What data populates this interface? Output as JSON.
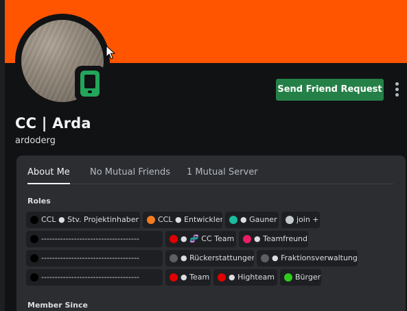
{
  "profile": {
    "display_name": "CC | Arda",
    "username": "ardoderg",
    "banner_color": "#ff5500",
    "status": "mobile-online",
    "status_color": "#23a55a"
  },
  "actions": {
    "send_friend_request_label": "Send Friend Request",
    "more_icon": "more-vertical-icon",
    "button_color": "#248046"
  },
  "tabs": [
    {
      "label": "About Me",
      "active": true
    },
    {
      "label": "No Mutual Friends",
      "active": false
    },
    {
      "label": "1 Mutual Server",
      "active": false
    }
  ],
  "roles": {
    "title": "Roles",
    "items": [
      {
        "label": "CCL ● Stv. Projektinhaber",
        "color": "#000000"
      },
      {
        "label": "CCL ● Entwickler",
        "color": "#f47b20"
      },
      {
        "label": "● Gauner",
        "color": "#1abc9c"
      },
      {
        "label": "join +",
        "color": "#c4c9ce"
      },
      {
        "label": "------------------------------------",
        "color": "#000000"
      },
      {
        "label": "● 🧬 CC Team",
        "color": "#e00000"
      },
      {
        "label": "● Teamfreund",
        "color": "#e91e63"
      },
      {
        "label": "------------------------------------",
        "color": "#000000"
      },
      {
        "label": "● Rückerstattungen",
        "color": "#5d5f63"
      },
      {
        "label": "● Fraktionsverwaltung",
        "color": "#5d5f63"
      },
      {
        "label": "------------------------------------",
        "color": "#000000"
      },
      {
        "label": "● Team",
        "color": "#e00000"
      },
      {
        "label": "● Highteam",
        "color": "#e00000"
      },
      {
        "label": "Bürger",
        "color": "#2ecc1a"
      }
    ]
  },
  "member_since": {
    "title": "Member Since"
  }
}
